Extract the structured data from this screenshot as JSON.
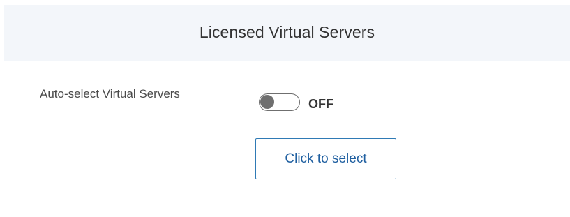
{
  "header": {
    "title": "Licensed Virtual Servers"
  },
  "auto_select": {
    "label": "Auto-select Virtual Servers",
    "toggle_state": "OFF",
    "toggle_on": false
  },
  "select_button": {
    "label": "Click to select"
  },
  "colors": {
    "header_bg": "#f3f6fa",
    "toggle_off": "#6f6f6f",
    "button_border": "#2f7ab5",
    "button_text": "#1f5fa0"
  }
}
